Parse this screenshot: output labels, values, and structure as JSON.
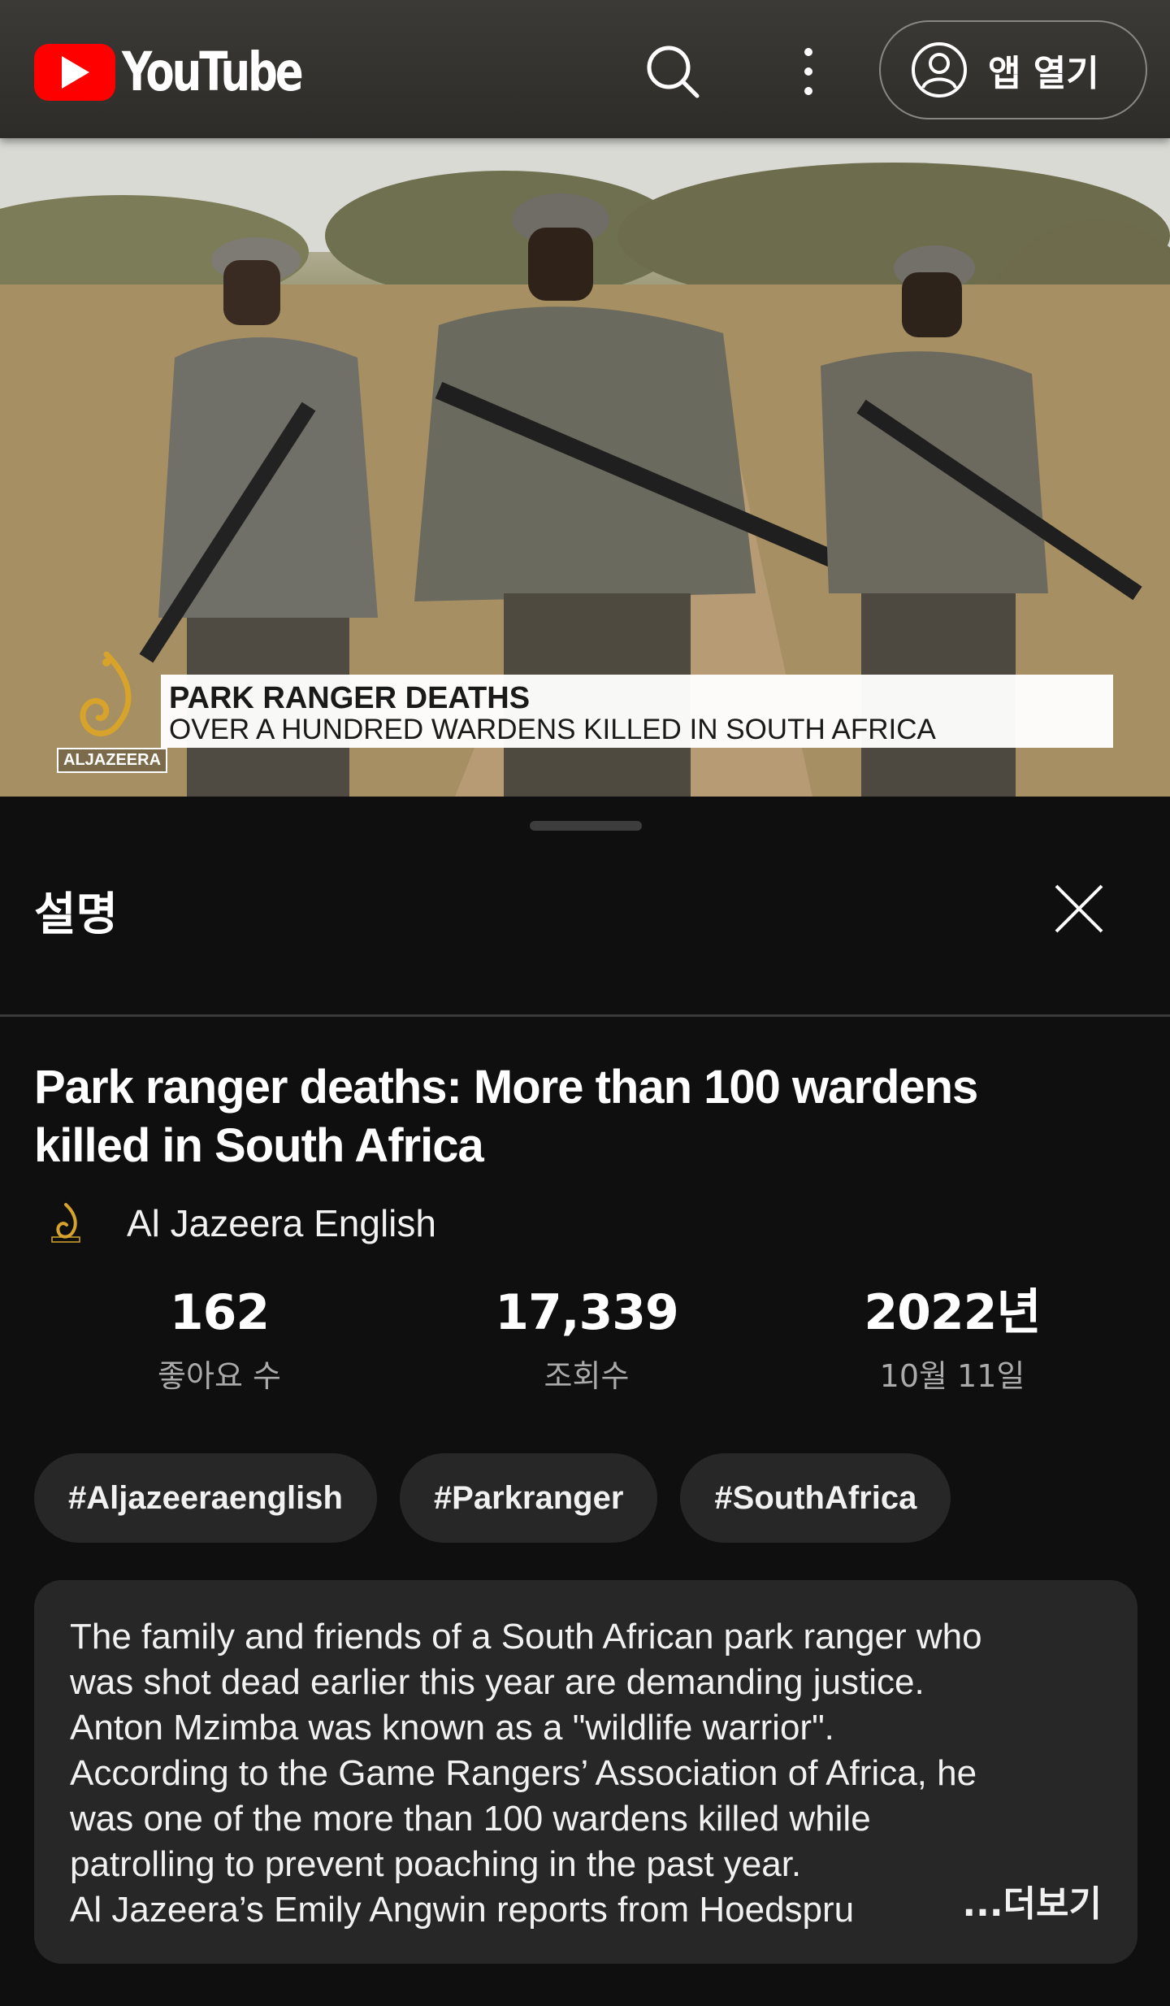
{
  "header": {
    "logo_text": "YouTube",
    "open_app_label": "앱 열기"
  },
  "video": {
    "lower_third_title": "PARK RANGER DEATHS",
    "lower_third_subtitle": "OVER A HUNDRED WARDENS KILLED IN SOUTH AFRICA",
    "watermark": "ALJAZEERA"
  },
  "sheet": {
    "heading": "설명",
    "title_line1": "Park ranger deaths: More than 100 wardens",
    "title_line2": "killed in South Africa",
    "channel_name": "Al Jazeera English",
    "stats": [
      {
        "value": "162",
        "label": "좋아요 수"
      },
      {
        "value": "17,339",
        "label": "조회수"
      },
      {
        "value": "2022년",
        "label": "10월 11일"
      }
    ],
    "tags": [
      "#Aljazeeraenglish",
      "#Parkranger",
      "#SouthAfrica"
    ],
    "description_lines": [
      "The family and friends of a South African park ranger who",
      "was shot dead earlier this year are demanding justice.",
      "Anton Mzimba was known as a \"wildlife warrior\".",
      "According to the Game Rangers’ Association of Africa, he",
      "was one of the more than 100 wardens killed while",
      "patrolling to prevent poaching in the past year.",
      "Al Jazeera’s Emily Angwin reports from Hoedspru"
    ],
    "more_label": "...더보기"
  },
  "colors": {
    "brand_red": "#ff0000",
    "background": "#0f0f0f",
    "chip": "#272727"
  }
}
